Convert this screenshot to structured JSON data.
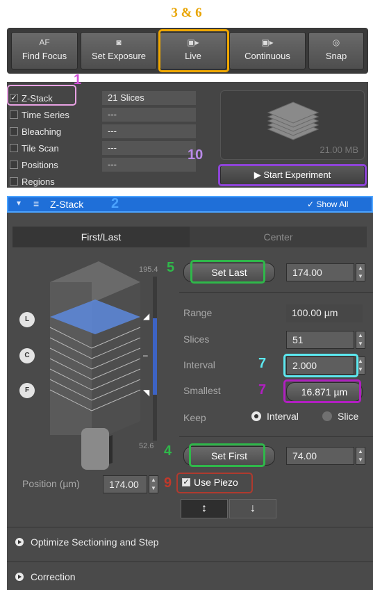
{
  "top_label": "3 & 6",
  "toolbar": {
    "buttons": [
      {
        "icon": "AF",
        "label": "Find Focus"
      },
      {
        "icon": "camera-icon",
        "label": "Set Exposure"
      },
      {
        "icon": "video-icon",
        "label": "Live"
      },
      {
        "icon": "continuous-icon",
        "label": "Continuous"
      },
      {
        "icon": "snap-camera-icon",
        "label": "Snap"
      }
    ]
  },
  "experiment": {
    "rows": [
      {
        "label": "Z-Stack",
        "checked": true,
        "value": "21 Slices"
      },
      {
        "label": "Time Series",
        "checked": false,
        "value": "---"
      },
      {
        "label": "Bleaching",
        "checked": false,
        "value": "---"
      },
      {
        "label": "Tile Scan",
        "checked": false,
        "value": "---"
      },
      {
        "label": "Positions",
        "checked": false,
        "value": "---"
      },
      {
        "label": "Regions",
        "checked": false,
        "value": ""
      }
    ],
    "preview_size": "21.00 MB",
    "start_label": "Start Experiment"
  },
  "zstack": {
    "header_title": "Z-Stack",
    "show_all": "Show All",
    "tabs": [
      "First/Last",
      "Center"
    ],
    "scale_top": "195.4",
    "scale_bottom": "52.6",
    "markers": [
      "L",
      "C",
      "F"
    ],
    "set_last_label": "Set Last",
    "set_last_value": "174.00",
    "range_label": "Range",
    "range_value": "100.00 µm",
    "slices_label": "Slices",
    "slices_value": "51",
    "interval_label": "Interval",
    "interval_value": "2.000",
    "smallest_label": "Smallest",
    "smallest_value": "16.871 µm",
    "keep_label": "Keep",
    "keep_interval": "Interval",
    "keep_slice": "Slice",
    "set_first_label": "Set First",
    "set_first_value": "74.00",
    "position_label": "Position (µm)",
    "position_value": "174.00",
    "use_piezo": "Use Piezo",
    "optimize_label": "Optimize Sectioning and Step",
    "correction_label": "Correction"
  },
  "annotations": [
    "1",
    "2",
    "4",
    "5",
    "7",
    "7",
    "9",
    "10"
  ],
  "colors": {
    "orange": "#f0a800",
    "pink": "#e9a2e4",
    "magenta": "#b01fc0",
    "purple": "#8e44d8",
    "green": "#2fb84a",
    "cyan": "#5ce8f0",
    "blue": "#4ba3ff",
    "red": "#b03a2e"
  }
}
